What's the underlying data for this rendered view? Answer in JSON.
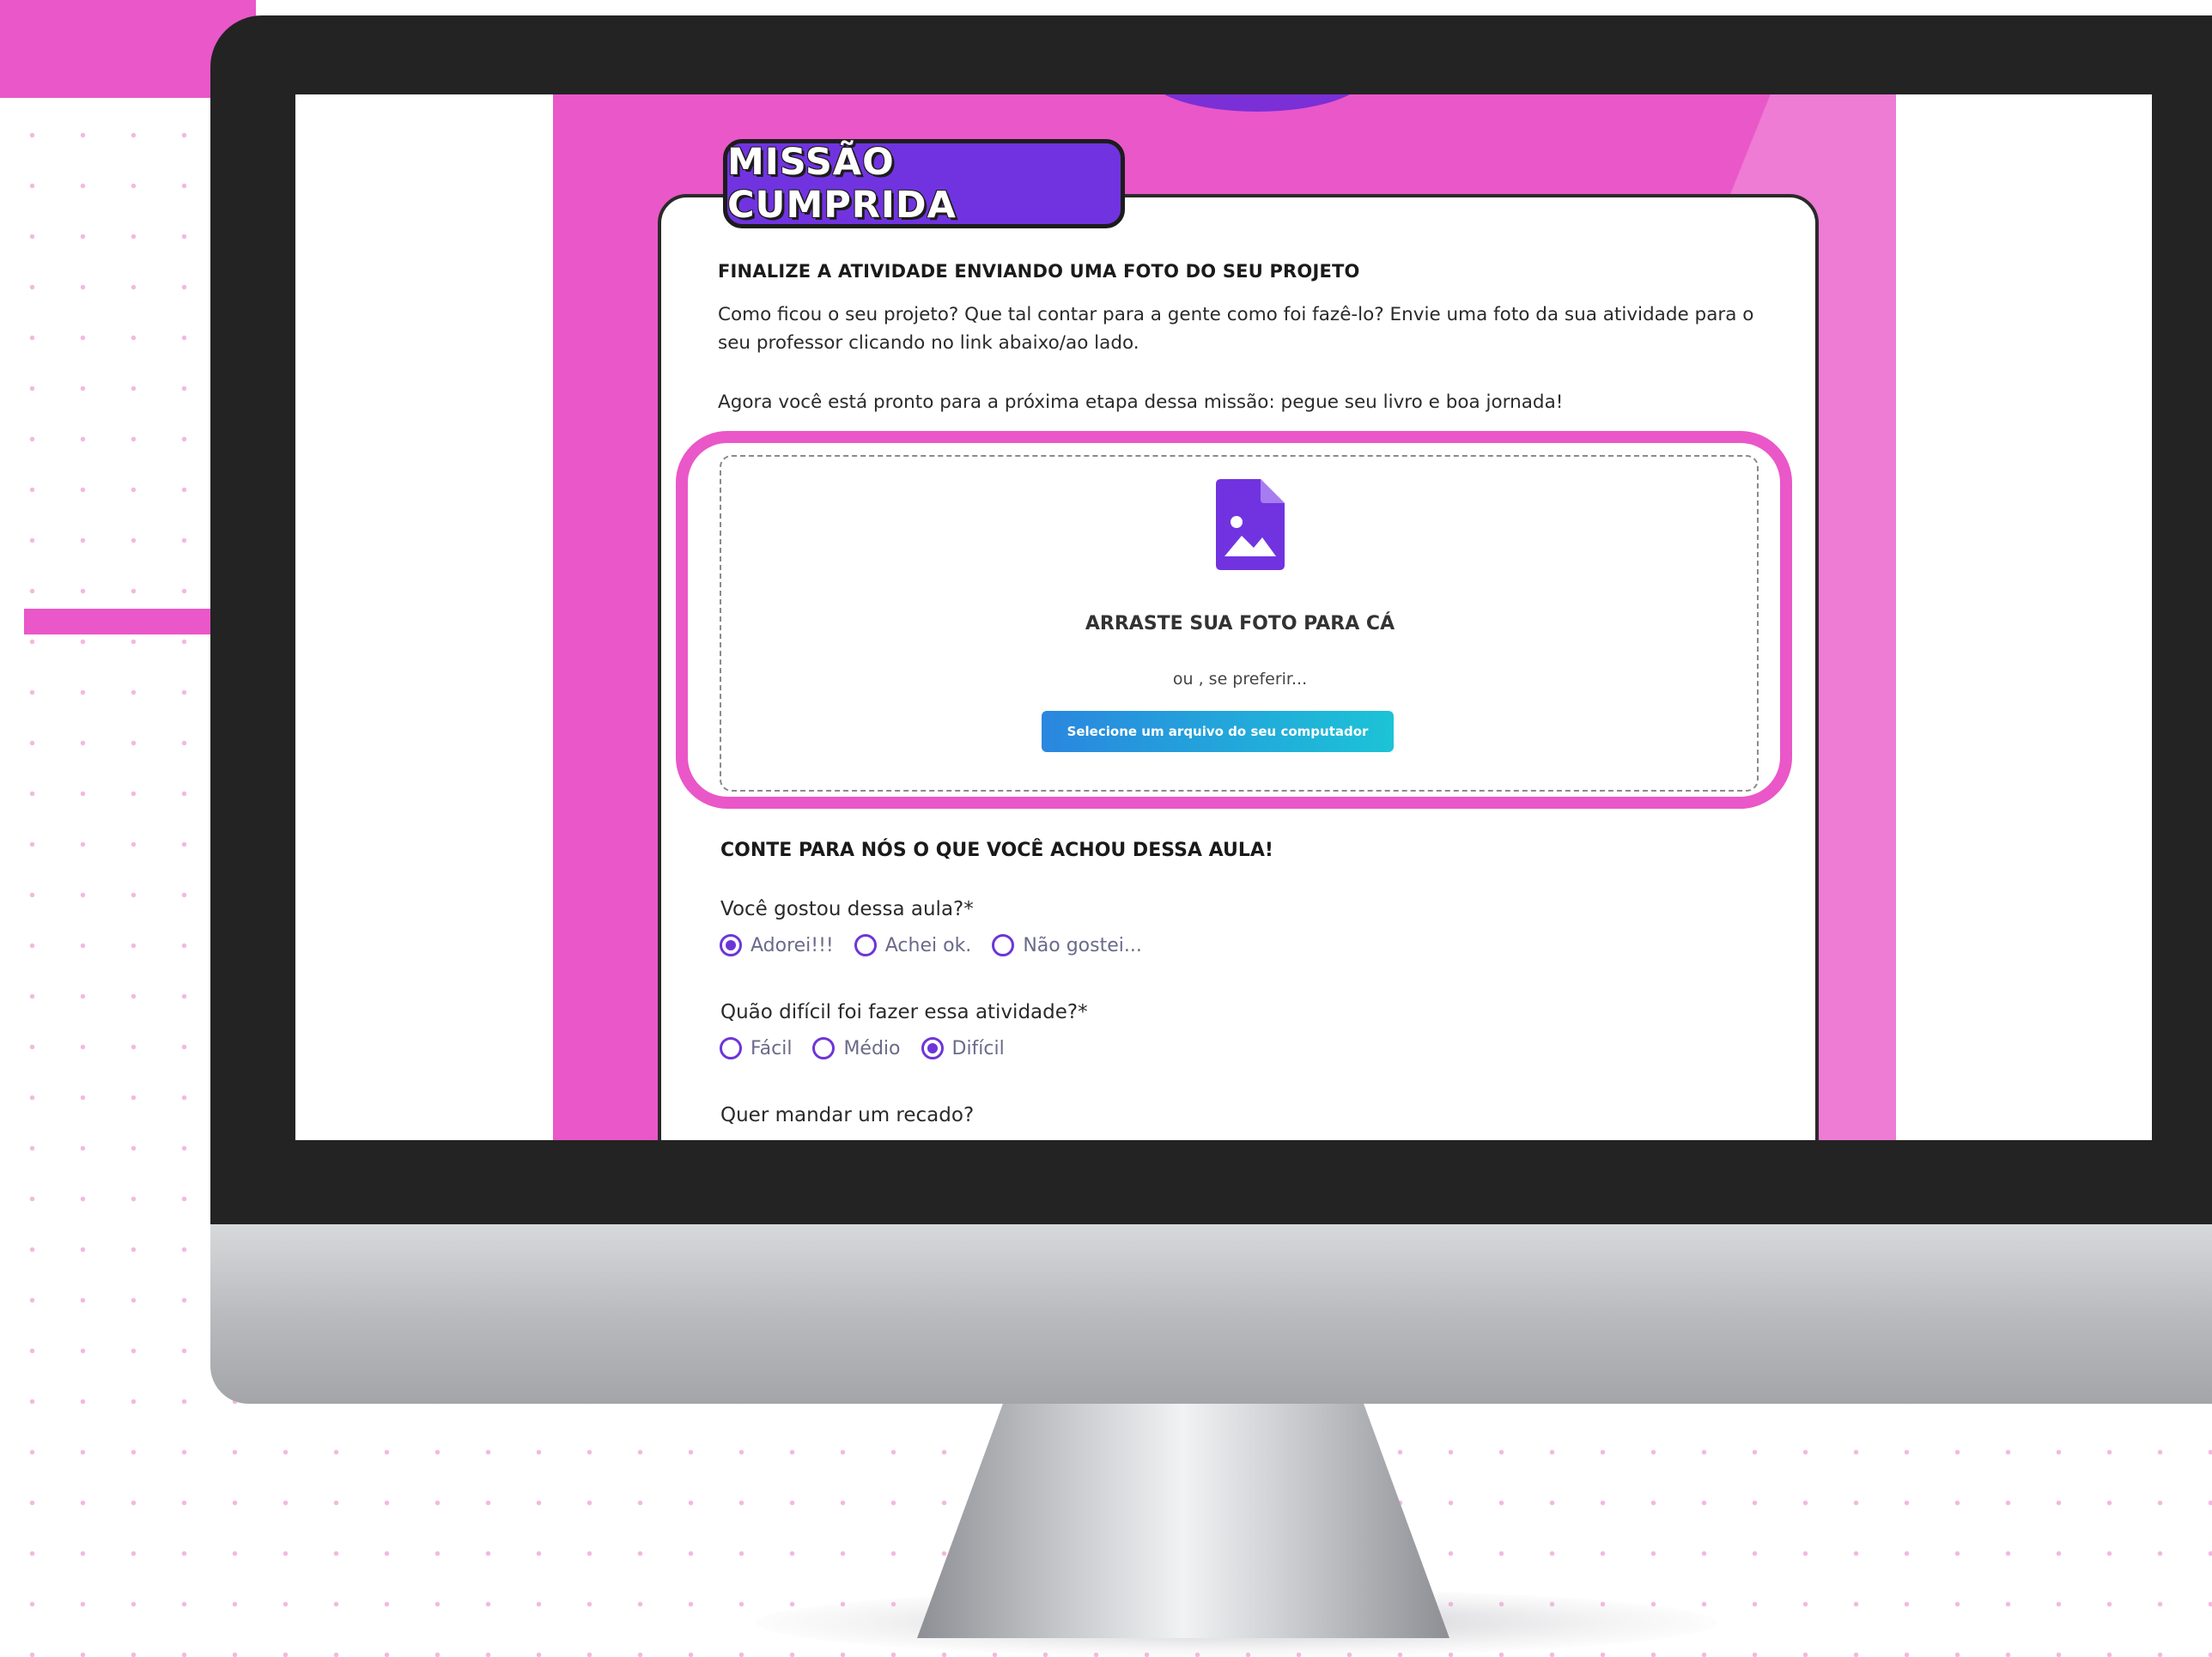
{
  "page": {
    "title": "MISSÃO CUMPRIDA",
    "section_title": "FINALIZE A ATIVIDADE ENVIANDO UMA FOTO DO SEU PROJETO",
    "paragraph1": "Como ficou o seu projeto? Que tal contar para a gente como foi fazê-lo? Envie uma foto da sua atividade para o seu professor clicando no link abaixo/ao lado.",
    "paragraph2": "Agora você está pronto para a próxima etapa dessa missão: pegue seu livro e boa jornada!"
  },
  "upload": {
    "icon": "image-file-icon",
    "drop_label": "ARRASTE SUA FOTO PARA CÁ",
    "or_text": "ou , se preferir...",
    "button_label": "Selecione um arquivo do seu computador"
  },
  "feedback": {
    "title": "CONTE PARA NÓS O QUE VOCÊ ACHOU DESSA AULA!",
    "q1": {
      "label": "Você gostou dessa aula?*",
      "options": [
        "Adorei!!!",
        "Achei ok.",
        "Não gostei..."
      ],
      "selected": "Adorei!!!"
    },
    "q2": {
      "label": "Quão difícil foi fazer essa atividade?*",
      "options": [
        "Fácil",
        "Médio",
        "Difícil"
      ],
      "selected": "Difícil"
    },
    "q3": {
      "label": "Quer mandar um recado?"
    }
  },
  "colors": {
    "accent_pink": "#ea57c8",
    "purple": "#7133e0",
    "button_gradient_start": "#2a86df",
    "button_gradient_end": "#1cc3d6"
  }
}
